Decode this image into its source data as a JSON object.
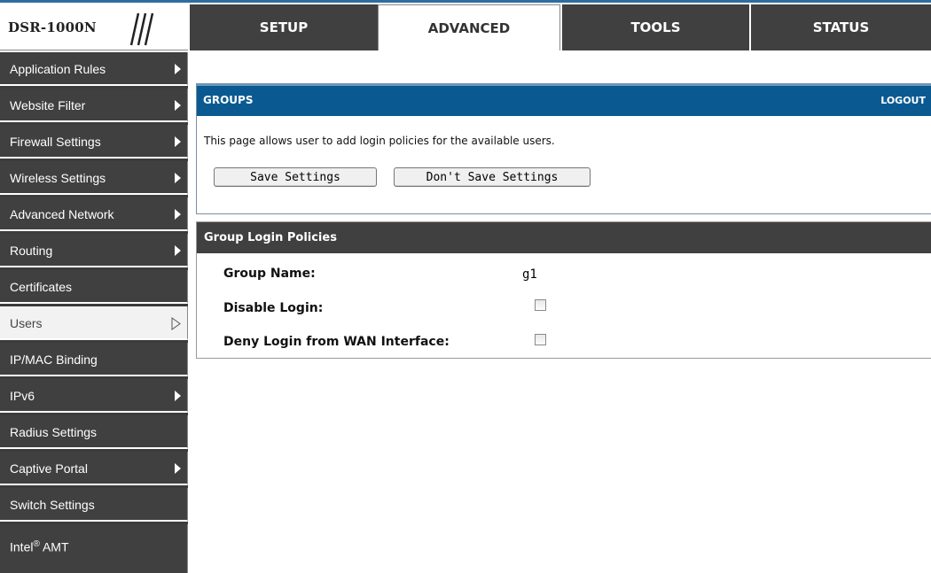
{
  "logo": {
    "text": "DSR-1000N"
  },
  "tabs": [
    {
      "label": "SETUP"
    },
    {
      "label": "ADVANCED"
    },
    {
      "label": "TOOLS"
    },
    {
      "label": "STATUS"
    }
  ],
  "sidebar": {
    "items": [
      {
        "label": "Application Rules"
      },
      {
        "label": "Website Filter"
      },
      {
        "label": "Firewall Settings"
      },
      {
        "label": "Wireless Settings"
      },
      {
        "label": "Advanced Network"
      },
      {
        "label": "Routing"
      },
      {
        "label": "Certificates"
      },
      {
        "label": "Users"
      },
      {
        "label": "IP/MAC Binding"
      },
      {
        "label": "IPv6"
      },
      {
        "label": "Radius Settings"
      },
      {
        "label": "Captive Portal"
      },
      {
        "label": "Switch Settings"
      },
      {
        "label_pre": "Intel",
        "label_sup": "®",
        "label_post": " AMT"
      }
    ]
  },
  "groups": {
    "title": "GROUPS",
    "logout": "LOGOUT",
    "description": "This page allows user to add login policies for the available users.",
    "save_button": "Save Settings",
    "dont_save_button": "Don't Save Settings"
  },
  "policies": {
    "title": "Group Login Policies",
    "group_name_label": "Group Name:",
    "group_name_value": "g1",
    "disable_login_label": "Disable Login:",
    "deny_wan_label": "Deny Login from WAN Interface:"
  }
}
